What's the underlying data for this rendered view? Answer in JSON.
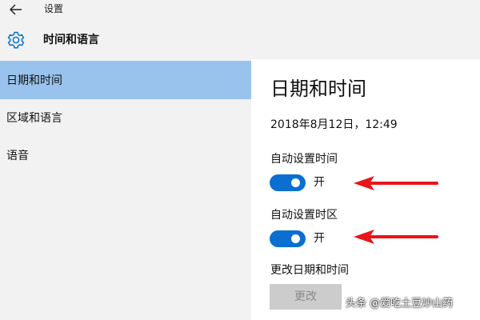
{
  "window": {
    "title": "设置"
  },
  "header": {
    "section_title": "时间和语言"
  },
  "sidebar": {
    "items": [
      {
        "label": "日期和时间",
        "selected": true
      },
      {
        "label": "区域和语言",
        "selected": false
      },
      {
        "label": "语音",
        "selected": false
      }
    ]
  },
  "main": {
    "heading": "日期和时间",
    "current_datetime": "2018年8月12日，12:49",
    "auto_time": {
      "label": "自动设置时间",
      "state": "开",
      "on": true
    },
    "auto_timezone": {
      "label": "自动设置时区",
      "state": "开",
      "on": true
    },
    "change_section": {
      "label": "更改日期和时间",
      "button": "更改"
    }
  },
  "watermark": "头条 @爱吃土豆炒山药",
  "colors": {
    "selected_nav": "#99c3ec",
    "toggle_on": "#0a6fd0",
    "annotation_arrow": "#e8151b",
    "disabled_button": "#cccccc"
  },
  "icons": [
    "back-arrow-icon",
    "gear-icon"
  ]
}
